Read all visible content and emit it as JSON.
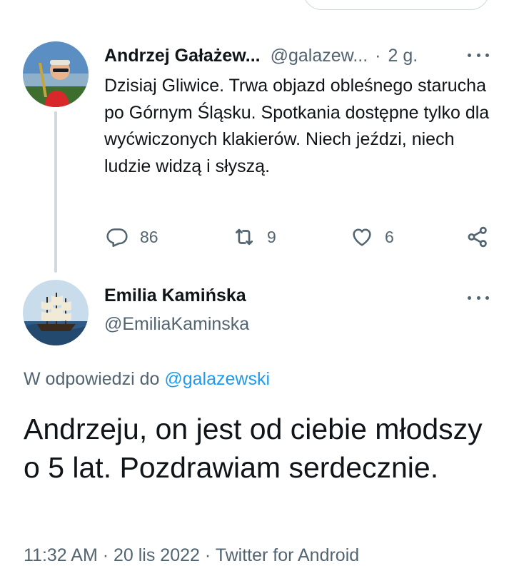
{
  "tweet1": {
    "author_name": "Andrzej Gałażew...",
    "author_handle": "@galazew...",
    "separator": "·",
    "time": "2 g.",
    "text": "Dzisiaj Gliwice. Trwa objazd obleśnego starucha po Górnym Śląsku. Spotkania dostępne tylko dla wyćwiczonych klakierów. Niech jeździ, niech ludzie widzą i słyszą.",
    "reply_count": "86",
    "retweet_count": "9",
    "like_count": "6"
  },
  "tweet2": {
    "author_name": "Emilia Kamińska",
    "author_handle": "@EmiliaKaminska",
    "reply_prefix": "W odpowiedzi do",
    "reply_handle": "@galazewski",
    "text": "Andrzeju, on jest od ciebie młodszy o 5 lat. Pozdrawiam serdecznie.",
    "time": "11:32 AM · 20 lis 2022 ·",
    "source": "Twitter for Android"
  },
  "colors": {
    "link": "#1d9bf0",
    "secondary_text": "#536471",
    "primary_text": "#0f1419",
    "thread_line": "#cfd9de"
  },
  "icons": [
    "reply-icon",
    "retweet-icon",
    "like-icon",
    "share-icon",
    "more-icon"
  ]
}
